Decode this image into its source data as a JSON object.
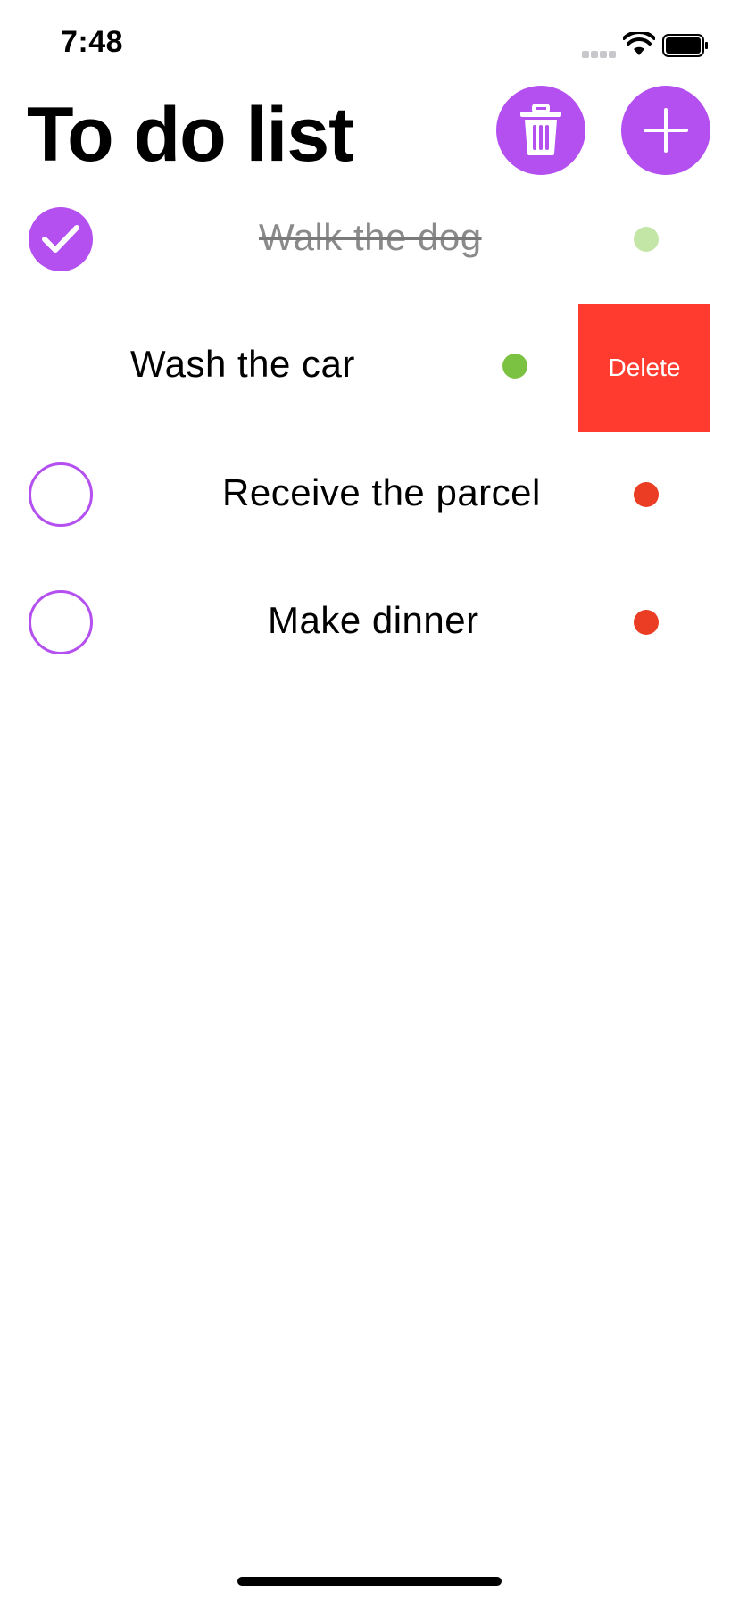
{
  "status_bar": {
    "time": "7:48"
  },
  "header": {
    "title": "To do list"
  },
  "toolbar": {
    "trash_icon": "trash-icon",
    "add_icon": "plus-icon"
  },
  "tasks": [
    {
      "label": "Walk the dog",
      "done": true,
      "priority_color": "#c3e5a6"
    },
    {
      "label": "Wash the car",
      "done": false,
      "priority_color": "#7cc242",
      "swiped": true
    },
    {
      "label": "Receive the parcel",
      "done": false,
      "priority_color": "#ea3d24"
    },
    {
      "label": "Make dinner",
      "done": false,
      "priority_color": "#ea3d24"
    }
  ],
  "swipe_action": {
    "label": "Delete",
    "color": "#ff3b30"
  },
  "colors": {
    "accent": "#b44ff0"
  }
}
